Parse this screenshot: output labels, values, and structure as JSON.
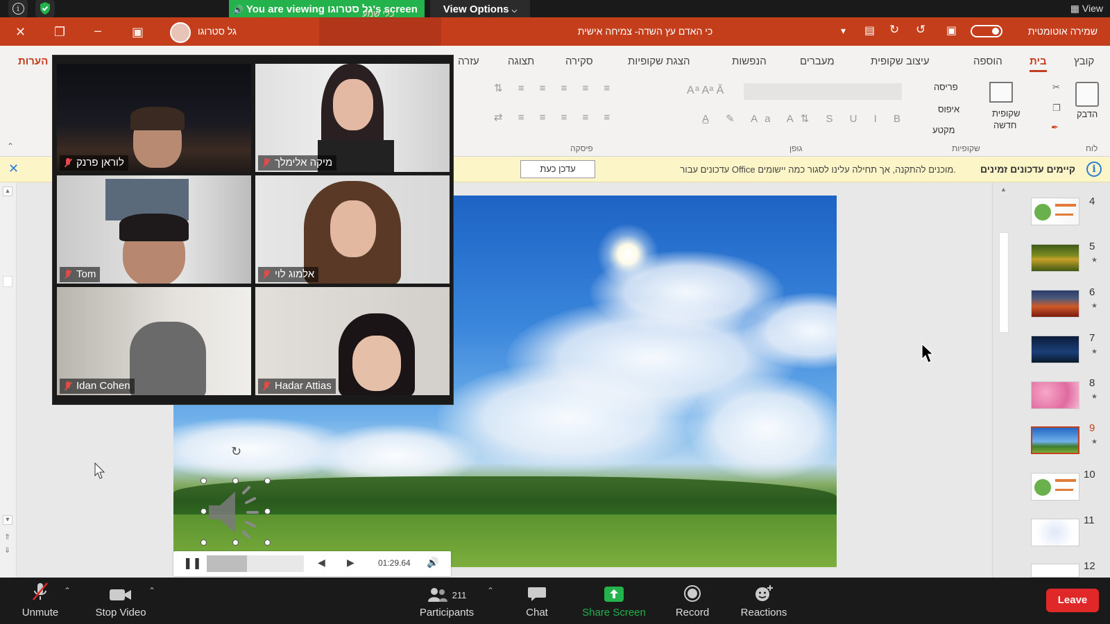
{
  "zoom_top": {
    "banner": "You are viewing גל סטרוגו's screen",
    "view_options": "View Options",
    "view": "View"
  },
  "ppt_titlebar": {
    "title": "כי האדם עץ השדה- צמיחה אישית",
    "autosave": "שמירה אוטומטית",
    "user_name": "גל סטרוגו",
    "search_label": "כלי שמע"
  },
  "ribbon": {
    "tabs": [
      "קובץ",
      "בית",
      "הוספה",
      "עיצוב שקופית",
      "מעברים",
      "הנפשות",
      "הצגת שקופיות",
      "סקירה",
      "תצוגה",
      "עזרה",
      "הערות"
    ],
    "groups": {
      "clipboard": "לוח",
      "slides": "שקופיות",
      "font": "גופן",
      "paragraph": "פיסקה"
    },
    "paste": "הדבק",
    "new_slide_line1": "שקופית",
    "new_slide_line2": "חדשה",
    "layout": "פריסה",
    "reset": "איפוס",
    "section": "מקטע"
  },
  "infobar": {
    "title": "קיימים עדכונים זמינים",
    "message": "עדכונים עבור Office מוכנים להתקנה, אך תחילה עלינו לסגור כמה יישומים.",
    "button": "עדכן כעת"
  },
  "participants": [
    {
      "name": "לוראן פרנק",
      "muted": true
    },
    {
      "name": "מיקה אלימלך",
      "muted": true
    },
    {
      "name": "Tom",
      "muted": true
    },
    {
      "name": "אלמוג לוי",
      "muted": true
    },
    {
      "name": "Idan Cohen",
      "muted": true
    },
    {
      "name": "Hadar Attias",
      "muted": true
    }
  ],
  "media": {
    "time": "01:29.64"
  },
  "slide_thumbnails": [
    {
      "num": "4"
    },
    {
      "num": "5"
    },
    {
      "num": "6"
    },
    {
      "num": "7"
    },
    {
      "num": "8"
    },
    {
      "num": "9",
      "selected": true
    },
    {
      "num": "10"
    },
    {
      "num": "11"
    },
    {
      "num": "12"
    }
  ],
  "bottom_bar": {
    "unmute": "Unmute",
    "stop_video": "Stop Video",
    "participants": "Participants",
    "participant_count": "211",
    "chat": "Chat",
    "share_screen": "Share Screen",
    "record": "Record",
    "reactions": "Reactions",
    "leave": "Leave"
  },
  "colors": {
    "ppt_accent": "#c43e1c",
    "zoom_green": "#23b24b",
    "leave_red": "#e02828"
  }
}
